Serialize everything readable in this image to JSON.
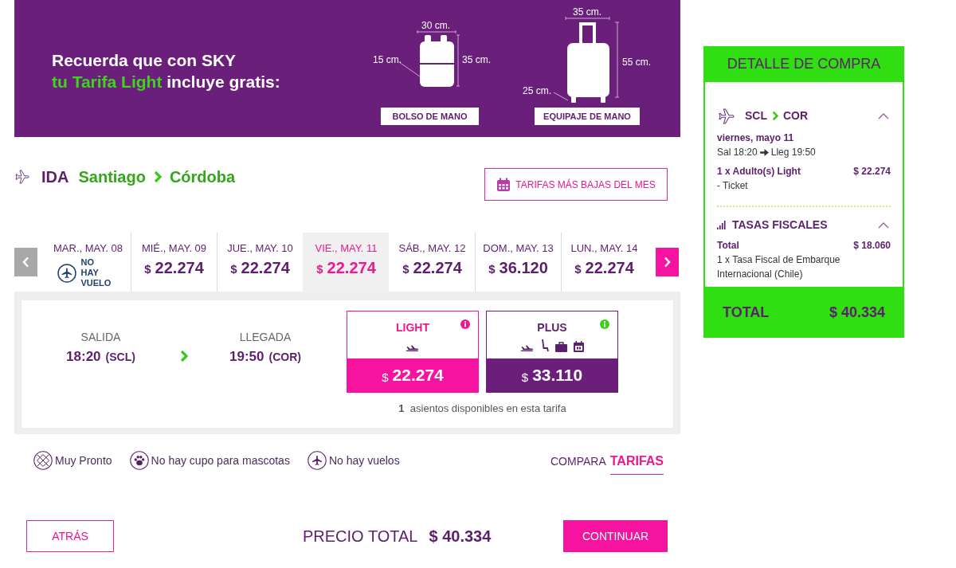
{
  "banner": {
    "line_1": "Recuerda que con SKY",
    "line_2": [
      {
        "text": "tu Tarifa Light",
        "color": "#3fd51c"
      },
      {
        "text": " incluye gratis:",
        "color": "#ffffff"
      }
    ],
    "items": [
      {
        "kind": "backpack",
        "width": "30 cm.",
        "depth": "15 cm.",
        "height": "35 cm.",
        "label": "BOLSO DE MANO"
      },
      {
        "kind": "suitcase",
        "width": "35 cm.",
        "depth": "25 cm.",
        "height": "55 cm.",
        "label": "EQUIPAJE DE MANO"
      }
    ]
  },
  "route": {
    "direction": "IDA",
    "origin": "Santiago",
    "destination": "Córdoba"
  },
  "lowest_fares_button": "TARIFAS MÁS BAJAS DEL MES",
  "dates": [
    {
      "label": "MAR., MAY. 08",
      "kind": "no_flight",
      "note": "NO HAY VUELO",
      "selected": false
    },
    {
      "label": "MIÉ., MAY. 09",
      "kind": "price",
      "currency": "$",
      "amount": "22.274",
      "selected": false
    },
    {
      "label": "JUE., MAY. 10",
      "kind": "price",
      "currency": "$",
      "amount": "22.274",
      "selected": false
    },
    {
      "label": "VIE., MAY. 11",
      "kind": "price",
      "currency": "$",
      "amount": "22.274",
      "selected": true
    },
    {
      "label": "SÁB., MAY. 12",
      "kind": "price",
      "currency": "$",
      "amount": "22.274",
      "selected": false
    },
    {
      "label": "DOM., MAY. 13",
      "kind": "price",
      "currency": "$",
      "amount": "36.120",
      "selected": false
    },
    {
      "label": "LUN., MAY. 14",
      "kind": "price",
      "currency": "$",
      "amount": "22.274",
      "selected": false
    }
  ],
  "flight": {
    "departure": {
      "label": "SALIDA",
      "time": "18:20",
      "airport": "(SCL)"
    },
    "arrival": {
      "label": "LLEGADA",
      "time": "19:50",
      "airport": "(COR)"
    },
    "fares": [
      {
        "name": "LIGHT",
        "selected": true,
        "features": [
          {
            "kind": "flight"
          }
        ],
        "currency": "$",
        "amount": "22.274"
      },
      {
        "name": "PLUS",
        "selected": false,
        "features": [
          {
            "kind": "flight"
          },
          {
            "kind": "seat"
          },
          {
            "kind": "baggage"
          },
          {
            "kind": "calendar"
          }
        ],
        "currency": "$",
        "amount": "33.110"
      }
    ],
    "seats_count": "1",
    "seats_text": "asientos disponibles en esta tarifa"
  },
  "legend": [
    {
      "kind": "soon",
      "text": "Muy Pronto"
    },
    {
      "kind": "no_pets",
      "text": "No hay cupo para mascotas"
    },
    {
      "kind": "no_flights",
      "text": "No hay vuelos"
    }
  ],
  "compare": {
    "prefix": "COMPARA",
    "link": "TARIFAS"
  },
  "footer": {
    "back_button": "ATRÁS",
    "total_label": "PRECIO TOTAL",
    "total_amount": "$ 40.334",
    "continue_button": "CONTINUAR"
  },
  "summary": {
    "title": "DETALLE DE COMPRA",
    "flight": {
      "origin": "SCL",
      "destination": "COR",
      "expanded": true,
      "date": "viernes, mayo 11",
      "departure": "Sal 18:20",
      "arrival": "Lleg 19:50",
      "item": "1 x Adulto(s) Light",
      "price": "$ 22.274",
      "item_detail": "- Ticket"
    },
    "taxes": {
      "title": "TASAS FISCALES",
      "expanded": true,
      "total_label": "Total",
      "total": "$ 18.060",
      "detail": "1 x Tasa Fiscal de Embarque Internacional (Chile)"
    },
    "total_label": "TOTAL",
    "total": "$ 40.334"
  }
}
